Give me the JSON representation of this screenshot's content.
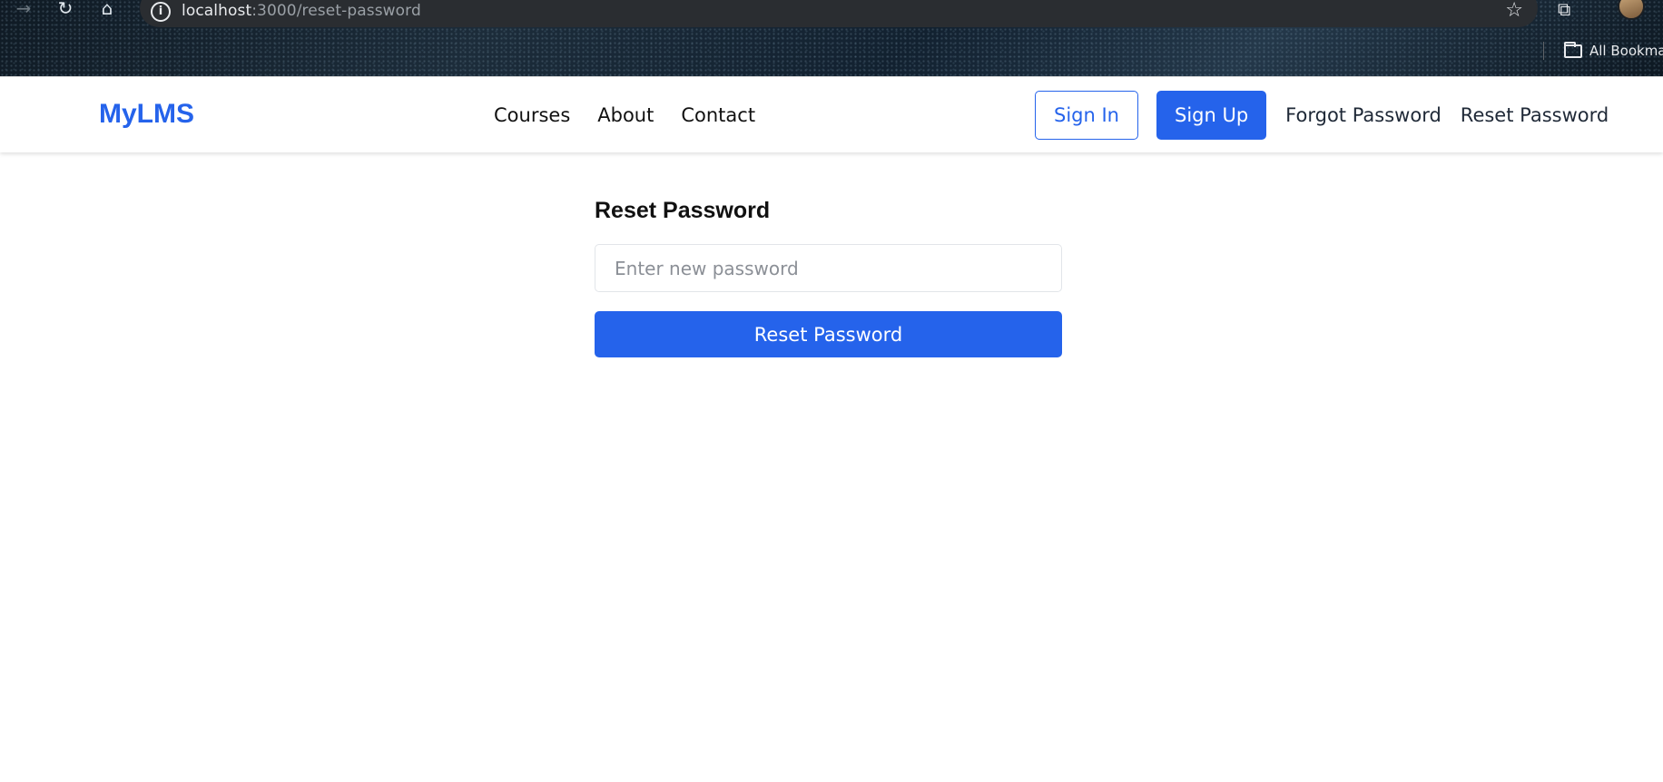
{
  "browser": {
    "url_host": "localhost",
    "url_path": ":3000/reset-password",
    "bookmarks_label": "All Bookma"
  },
  "header": {
    "brand": "MyLMS",
    "nav": {
      "courses": "Courses",
      "about": "About",
      "contact": "Contact"
    },
    "auth": {
      "sign_in": "Sign In",
      "sign_up": "Sign Up",
      "forgot_password": "Forgot Password",
      "reset_password": "Reset Password"
    }
  },
  "reset_form": {
    "title": "Reset Password",
    "password_placeholder": "Enter new password",
    "password_value": "",
    "submit_label": "Reset Password"
  },
  "colors": {
    "primary": "#2563eb",
    "header_bg": "#ffffff",
    "text": "#111111"
  },
  "icons": {
    "forward": "forward-arrow-icon",
    "reload": "reload-icon",
    "home": "home-icon",
    "site_info": "info-icon",
    "bookmark": "star-icon",
    "extensions": "puzzle-icon",
    "profile": "avatar",
    "bookmarks_folder": "folder-icon"
  }
}
